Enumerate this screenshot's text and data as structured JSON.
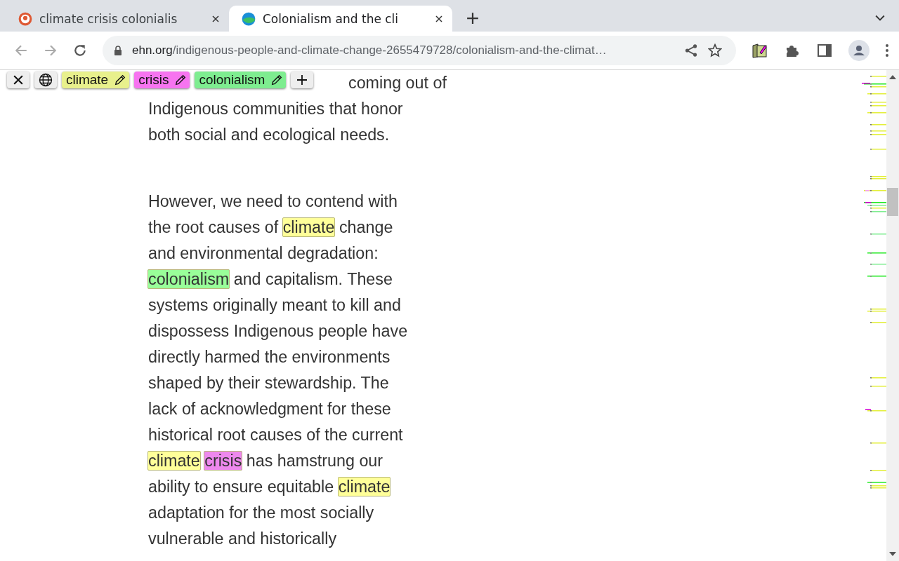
{
  "tabs": [
    {
      "title": "climate crisis colonialis",
      "selected": false
    },
    {
      "title": "Colonialism and the cli",
      "selected": true
    }
  ],
  "address": {
    "domain": "ehn.org",
    "path": "/indigenous-people-and-climate-change-2655479728/colonialism-and-the-climat…"
  },
  "highlighter": {
    "terms": [
      {
        "label": "climate",
        "color": "#e8f08c"
      },
      {
        "label": "crisis",
        "color": "#f774f0"
      },
      {
        "label": "colonialism",
        "color": "#7eed90"
      }
    ]
  },
  "article": {
    "intro_lines": [
      "coming out of",
      "Indigenous communities that honor",
      "both social and ecological needs."
    ],
    "paragraph": [
      {
        "text": "However, we need to contend with the root causes of "
      },
      {
        "text": "climate",
        "color": "#ffff99"
      },
      {
        "text": " change and environmental degradation: "
      },
      {
        "text": "colonialism",
        "color": "#99ff99"
      },
      {
        "text": " and capitalism. These systems originally meant to kill and dispossess Indigenous people have directly harmed the environments shaped by their stewardship. The lack of acknowledgment for these historical root causes of the current "
      },
      {
        "text": "climate",
        "color": "#ffff99"
      },
      {
        "text": "crisis",
        "color": "#ee88ee"
      },
      {
        "text": " has hamstrung our ability to ensure equitable "
      },
      {
        "text": "climate",
        "color": "#ffff99"
      },
      {
        "text": " adaptation for the most socially vulnerable and historically"
      }
    ]
  }
}
